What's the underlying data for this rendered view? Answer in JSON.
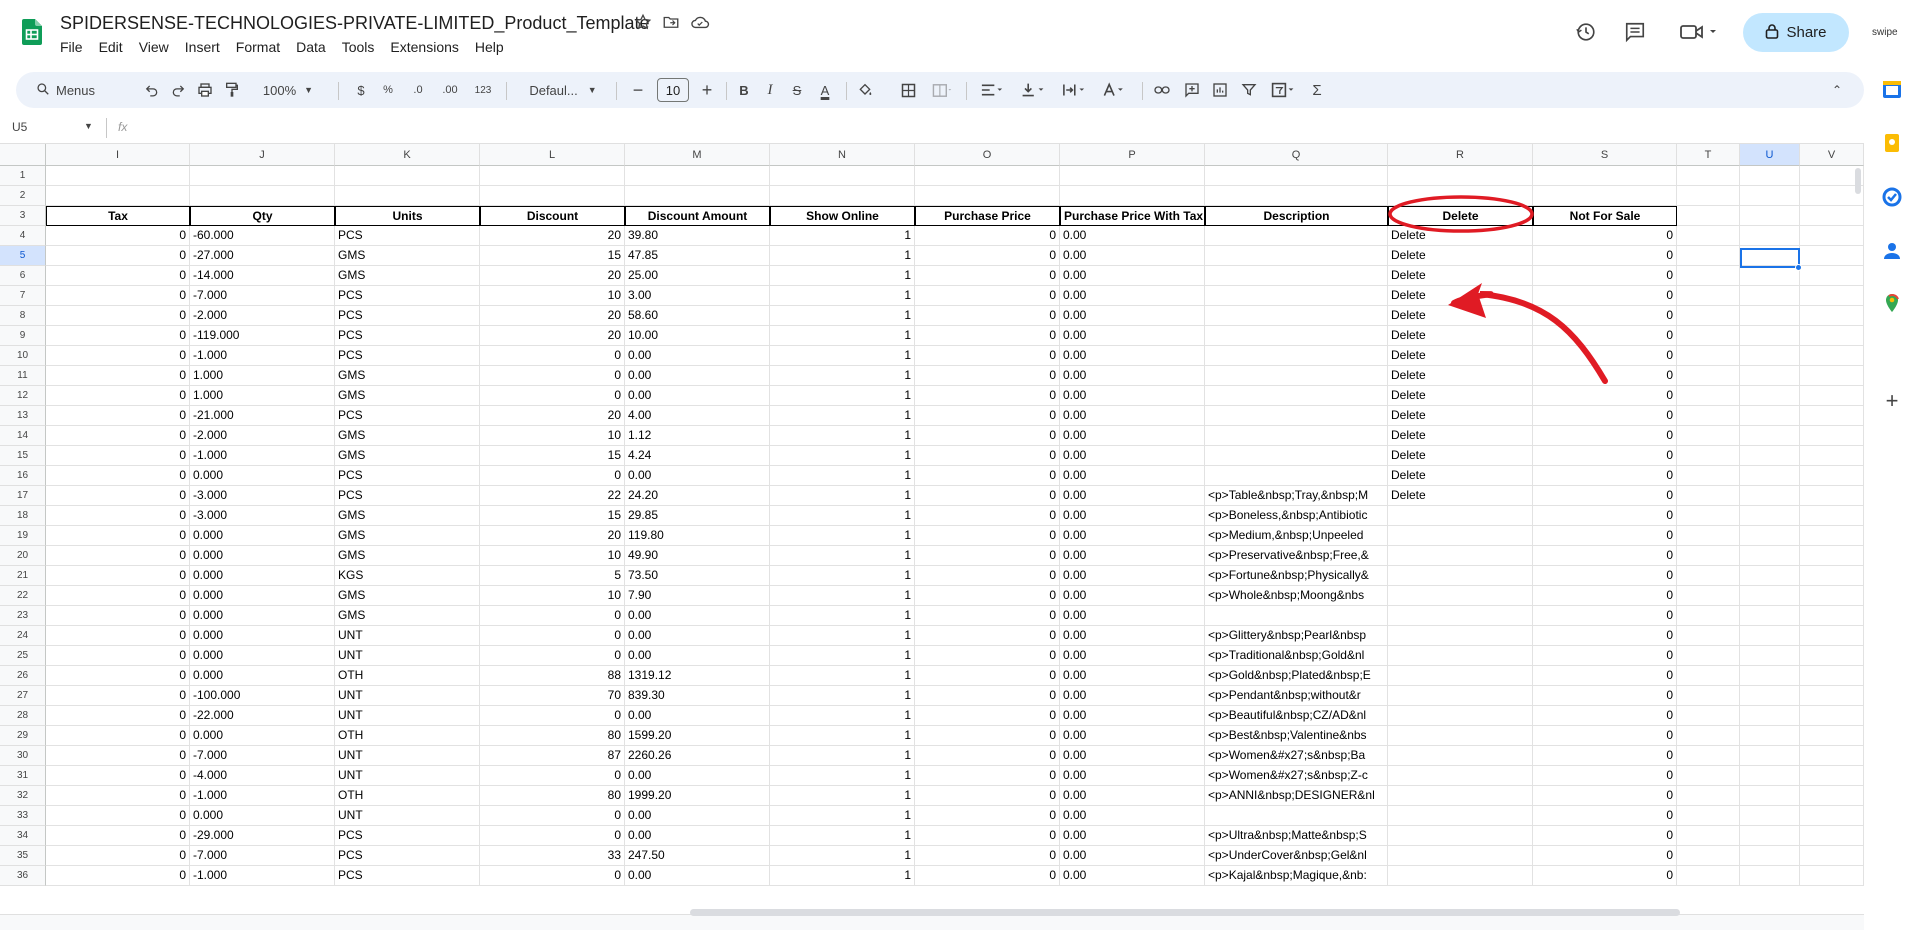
{
  "app": {
    "title": "SPIDERSENSE-TECHNOLOGIES-PRIVATE-LIMITED_Product_Template",
    "menu": [
      "File",
      "Edit",
      "View",
      "Insert",
      "Format",
      "Data",
      "Tools",
      "Extensions",
      "Help"
    ],
    "share_label": "Share",
    "avatar_label": "swipe"
  },
  "toolbar": {
    "menus_label": "Menus",
    "zoom": "100%",
    "currency": "$",
    "percent": "%",
    "dec_decrease": ".0",
    "dec_increase": ".00",
    "number_format": "123",
    "font": "Defaul...",
    "font_size": "10",
    "bold": "B",
    "italic": "I",
    "strike": "S",
    "text_color": "A",
    "sigma": "Σ"
  },
  "formula_bar": {
    "cell_ref": "U5",
    "fx": "fx",
    "value": ""
  },
  "columns": [
    "I",
    "J",
    "K",
    "L",
    "M",
    "N",
    "O",
    "P",
    "Q",
    "R",
    "S",
    "T",
    "U",
    "V"
  ],
  "selected_column": "U",
  "selected_row": 5,
  "header_row": [
    "Tax",
    "Qty",
    "Units",
    "Discount",
    "Discount Amount",
    "Show Online",
    "Purchase Price",
    "Purchase Price With Tax",
    "Description",
    "Delete",
    "Not For Sale"
  ],
  "rows": [
    [
      "0",
      "-60.000",
      "PCS",
      "20",
      "39.80",
      "1",
      "0",
      "0.00",
      "",
      "Delete",
      "0"
    ],
    [
      "0",
      "-27.000",
      "GMS",
      "15",
      "47.85",
      "1",
      "0",
      "0.00",
      "",
      "Delete",
      "0"
    ],
    [
      "0",
      "-14.000",
      "GMS",
      "20",
      "25.00",
      "1",
      "0",
      "0.00",
      "",
      "Delete",
      "0"
    ],
    [
      "0",
      "-7.000",
      "PCS",
      "10",
      "3.00",
      "1",
      "0",
      "0.00",
      "",
      "Delete",
      "0"
    ],
    [
      "0",
      "-2.000",
      "PCS",
      "20",
      "58.60",
      "1",
      "0",
      "0.00",
      "",
      "Delete",
      "0"
    ],
    [
      "0",
      "-119.000",
      "PCS",
      "20",
      "10.00",
      "1",
      "0",
      "0.00",
      "",
      "Delete",
      "0"
    ],
    [
      "0",
      "-1.000",
      "PCS",
      "0",
      "0.00",
      "1",
      "0",
      "0.00",
      "",
      "Delete",
      "0"
    ],
    [
      "0",
      "1.000",
      "GMS",
      "0",
      "0.00",
      "1",
      "0",
      "0.00",
      "",
      "Delete",
      "0"
    ],
    [
      "0",
      "1.000",
      "GMS",
      "0",
      "0.00",
      "1",
      "0",
      "0.00",
      "",
      "Delete",
      "0"
    ],
    [
      "0",
      "-21.000",
      "PCS",
      "20",
      "4.00",
      "1",
      "0",
      "0.00",
      "",
      "Delete",
      "0"
    ],
    [
      "0",
      "-2.000",
      "GMS",
      "10",
      "1.12",
      "1",
      "0",
      "0.00",
      "",
      "Delete",
      "0"
    ],
    [
      "0",
      "-1.000",
      "GMS",
      "15",
      "4.24",
      "1",
      "0",
      "0.00",
      "",
      "Delete",
      "0"
    ],
    [
      "0",
      "0.000",
      "PCS",
      "0",
      "0.00",
      "1",
      "0",
      "0.00",
      "",
      "Delete",
      "0"
    ],
    [
      "0",
      "-3.000",
      "PCS",
      "22",
      "24.20",
      "1",
      "0",
      "0.00",
      "<p>Table&nbsp;Tray,&nbsp;M",
      "Delete",
      "0"
    ],
    [
      "0",
      "-3.000",
      "GMS",
      "15",
      "29.85",
      "1",
      "0",
      "0.00",
      "<p>Boneless,&nbsp;Antibiotic",
      "",
      "0"
    ],
    [
      "0",
      "0.000",
      "GMS",
      "20",
      "119.80",
      "1",
      "0",
      "0.00",
      "<p>Medium,&nbsp;Unpeeled",
      "",
      "0"
    ],
    [
      "0",
      "0.000",
      "GMS",
      "10",
      "49.90",
      "1",
      "0",
      "0.00",
      "<p>Preservative&nbsp;Free,&",
      "",
      "0"
    ],
    [
      "0",
      "0.000",
      "KGS",
      "5",
      "73.50",
      "1",
      "0",
      "0.00",
      "<p>Fortune&nbsp;Physically&",
      "",
      "0"
    ],
    [
      "0",
      "0.000",
      "GMS",
      "10",
      "7.90",
      "1",
      "0",
      "0.00",
      "<p>Whole&nbsp;Moong&nbs",
      "",
      "0"
    ],
    [
      "0",
      "0.000",
      "GMS",
      "0",
      "0.00",
      "1",
      "0",
      "0.00",
      "",
      "",
      "0"
    ],
    [
      "0",
      "0.000",
      "UNT",
      "0",
      "0.00",
      "1",
      "0",
      "0.00",
      "<p>Glittery&nbsp;Pearl&nbsp",
      "",
      "0"
    ],
    [
      "0",
      "0.000",
      "UNT",
      "0",
      "0.00",
      "1",
      "0",
      "0.00",
      "<p>Traditional&nbsp;Gold&nl",
      "",
      "0"
    ],
    [
      "0",
      "0.000",
      "OTH",
      "88",
      "1319.12",
      "1",
      "0",
      "0.00",
      "<p>Gold&nbsp;Plated&nbsp;E",
      "",
      "0"
    ],
    [
      "0",
      "-100.000",
      "UNT",
      "70",
      "839.30",
      "1",
      "0",
      "0.00",
      "<p>Pendant&nbsp;without&r",
      "",
      "0"
    ],
    [
      "0",
      "-22.000",
      "UNT",
      "0",
      "0.00",
      "1",
      "0",
      "0.00",
      "<p>Beautiful&nbsp;CZ/AD&nl",
      "",
      "0"
    ],
    [
      "0",
      "0.000",
      "OTH",
      "80",
      "1599.20",
      "1",
      "0",
      "0.00",
      "<p>Best&nbsp;Valentine&nbs",
      "",
      "0"
    ],
    [
      "0",
      "-7.000",
      "UNT",
      "87",
      "2260.26",
      "1",
      "0",
      "0.00",
      "<p>Women&#x27;s&nbsp;Ba",
      "",
      "0"
    ],
    [
      "0",
      "-4.000",
      "UNT",
      "0",
      "0.00",
      "1",
      "0",
      "0.00",
      "<p>Women&#x27;s&nbsp;Z-c",
      "",
      "0"
    ],
    [
      "0",
      "-1.000",
      "OTH",
      "80",
      "1999.20",
      "1",
      "0",
      "0.00",
      "<p>ANNI&nbsp;DESIGNER&nl",
      "",
      "0"
    ],
    [
      "0",
      "0.000",
      "UNT",
      "0",
      "0.00",
      "1",
      "0",
      "0.00",
      "",
      "",
      "0"
    ],
    [
      "0",
      "-29.000",
      "PCS",
      "0",
      "0.00",
      "1",
      "0",
      "0.00",
      "<p>Ultra&nbsp;Matte&nbsp;S",
      "",
      "0"
    ],
    [
      "0",
      "-7.000",
      "PCS",
      "33",
      "247.50",
      "1",
      "0",
      "0.00",
      "<p>UnderCover&nbsp;Gel&nl",
      "",
      "0"
    ],
    [
      "0",
      "-1.000",
      "PCS",
      "0",
      "0.00",
      "1",
      "0",
      "0.00",
      "<p>Kajal&nbsp;Magique,&nb:",
      "",
      "0"
    ]
  ],
  "colors": {
    "accent": "#1a73e8",
    "share_bg": "#c2e7ff",
    "annotation": "#e01b24",
    "toolbar_bg": "#edf2fa"
  }
}
